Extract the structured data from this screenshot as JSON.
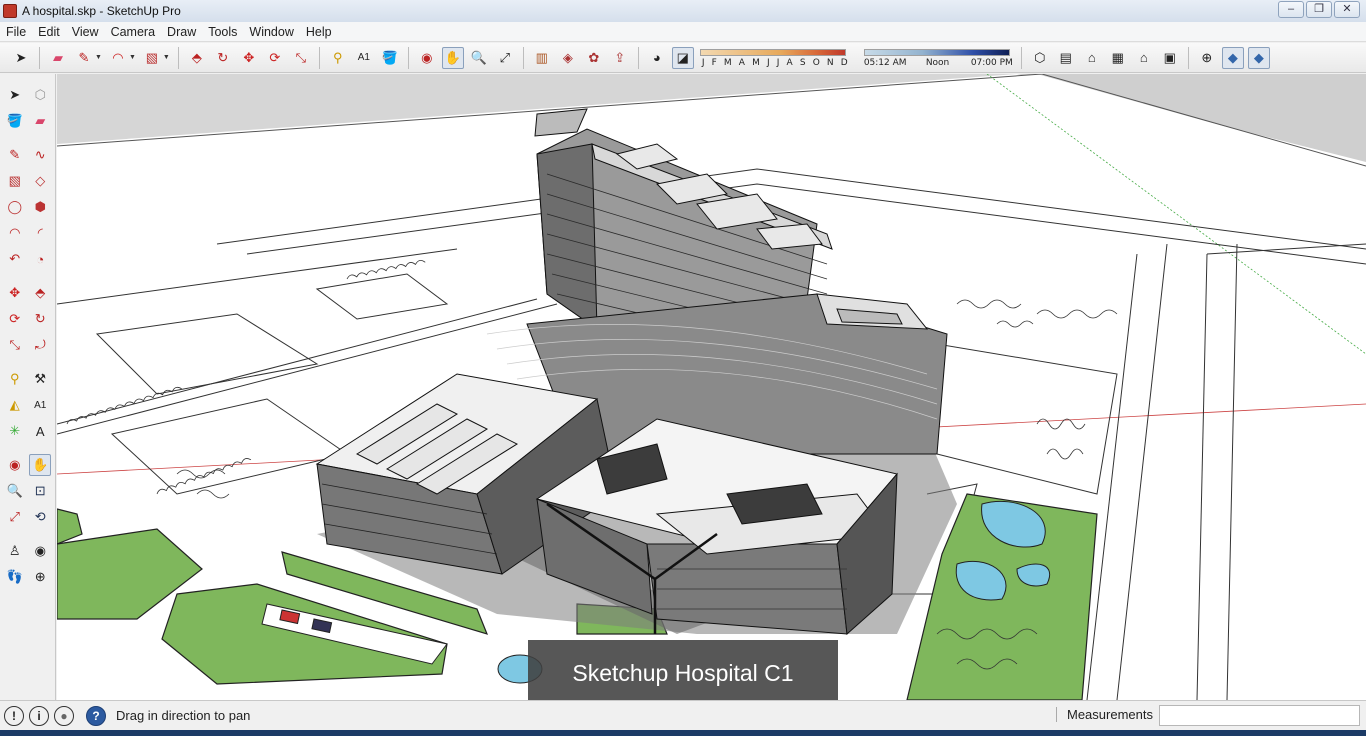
{
  "window": {
    "title": "A hospital.skp - SketchUp Pro"
  },
  "menu": [
    "File",
    "Edit",
    "View",
    "Camera",
    "Draw",
    "Tools",
    "Window",
    "Help"
  ],
  "shadows": {
    "months": [
      "J",
      "F",
      "M",
      "A",
      "M",
      "J",
      "J",
      "A",
      "S",
      "O",
      "N",
      "D"
    ],
    "time_start": "05:12 AM",
    "time_mid": "Noon",
    "time_end": "07:00 PM"
  },
  "toolbar_icons": [
    "select-icon",
    "eraser-icon",
    "pencil-icon",
    "circle-icon",
    "rectangle-icon",
    "push-pull-icon",
    "follow-me-icon",
    "move-icon",
    "rotate-icon",
    "scale-icon",
    "tape-measure-icon",
    "text-icon",
    "paint-bucket-icon",
    "orbit-icon",
    "pan-icon",
    "zoom-icon",
    "zoom-extents-icon",
    "3d-warehouse-icon",
    "components-icon",
    "extension-icon",
    "export-icon",
    "shadow-icon",
    "fog-icon",
    "iso-view-icon",
    "top-view-icon",
    "front-view-icon",
    "right-view-icon",
    "back-view-icon",
    "left-view-icon",
    "xray-icon",
    "section-icon",
    "section-display-icon"
  ],
  "viewport": {
    "caption": "Sketchup Hospital C1"
  },
  "status": {
    "hint": "Drag in direction to pan",
    "measurements_label": "Measurements",
    "measurements_value": ""
  },
  "colors": {
    "grass": "#7fb75c",
    "water": "#7ec8e3",
    "paper": "#ffffff",
    "ink": "#1a1a1a"
  }
}
